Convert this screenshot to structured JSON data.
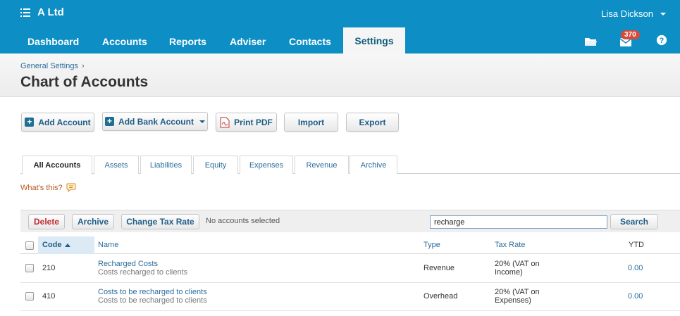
{
  "top_bar": {
    "org_name": "A Ltd",
    "user_name": "Lisa Dickson"
  },
  "nav": {
    "items": [
      {
        "label": "Dashboard"
      },
      {
        "label": "Accounts"
      },
      {
        "label": "Reports"
      },
      {
        "label": "Adviser"
      },
      {
        "label": "Contacts"
      },
      {
        "label": "Settings",
        "active": true
      }
    ],
    "icons": [
      "folder-icon",
      "mail-icon",
      "help-icon"
    ],
    "mail_badge": "370"
  },
  "header": {
    "breadcrumb": "General Settings",
    "title": "Chart of Accounts"
  },
  "actions": {
    "add_account": "Add Account",
    "add_bank_account": "Add Bank Account",
    "print_pdf": "Print PDF",
    "import": "Import",
    "export": "Export"
  },
  "tabs": [
    {
      "label": "All Accounts",
      "active": true
    },
    {
      "label": "Assets"
    },
    {
      "label": "Liabilities"
    },
    {
      "label": "Equity"
    },
    {
      "label": "Expenses"
    },
    {
      "label": "Revenue"
    },
    {
      "label": "Archive"
    }
  ],
  "whats_this": "What's this?",
  "toolbar": {
    "delete": "Delete",
    "archive": "Archive",
    "change_tax_rate": "Change Tax Rate",
    "selection_status": "No accounts selected",
    "search_value": "recharge",
    "search_button": "Search"
  },
  "table": {
    "columns": {
      "code": "Code",
      "name": "Name",
      "type": "Type",
      "tax_rate": "Tax Rate",
      "ytd": "YTD"
    },
    "rows": [
      {
        "code": "210",
        "name": "Recharged Costs",
        "description": "Costs recharged to clients",
        "type": "Revenue",
        "tax_line1": "20% (VAT on",
        "tax_line2": "Income)",
        "ytd": "0.00"
      },
      {
        "code": "410",
        "name": "Costs to be recharged to clients",
        "description": "Costs to be recharged to clients",
        "type": "Overhead",
        "tax_line1": "20% (VAT on",
        "tax_line2": "Expenses)",
        "ytd": "0.00"
      }
    ]
  },
  "colors": {
    "brand_blue": "#0d8fc6",
    "link_blue": "#2b6d9c",
    "danger_red": "#c0282e",
    "badge_red": "#d64a3a"
  }
}
